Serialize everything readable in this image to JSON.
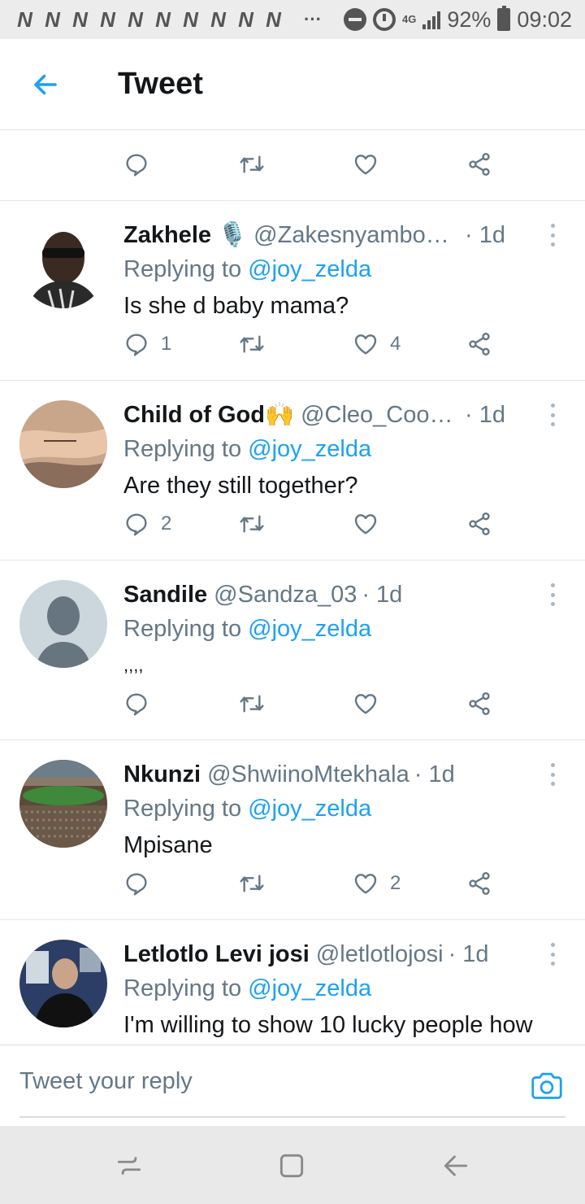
{
  "status_bar": {
    "notifications": [
      "N",
      "N",
      "N",
      "N",
      "N",
      "N",
      "N",
      "N",
      "N",
      "N"
    ],
    "more": "···",
    "network": "4G",
    "battery": "92%",
    "time": "09:02"
  },
  "header": {
    "title": "Tweet"
  },
  "tweets": [
    {
      "name": "Zakhele 🎙️",
      "handle": "@Zakesnyambose_",
      "time": "· 1d",
      "reply_prefix": "Replying to ",
      "reply_to": "@joy_zelda",
      "text": "Is she d baby mama?",
      "reply_count": "1",
      "like_count": "4"
    },
    {
      "name": "Child of God🙌",
      "handle": "@Cleo_Cooper...",
      "time": "· 1d",
      "reply_prefix": "Replying to ",
      "reply_to": "@joy_zelda",
      "text": "Are they still together?",
      "reply_count": "2",
      "like_count": ""
    },
    {
      "name": "Sandile",
      "handle": "@Sandza_03",
      "time": "· 1d",
      "reply_prefix": "Replying to ",
      "reply_to": "@joy_zelda",
      "text": ",,,,",
      "reply_count": "",
      "like_count": ""
    },
    {
      "name": "Nkunzi",
      "handle": "@ShwiinoMtekhala",
      "time": "· 1d",
      "reply_prefix": "Replying to ",
      "reply_to": "@joy_zelda",
      "text": "Mpisane",
      "reply_count": "",
      "like_count": "2"
    },
    {
      "name": "Letlotlo Levi josi",
      "handle": "@letlotlojosi",
      "time": "· 1d",
      "reply_prefix": "Replying to ",
      "reply_to": "@joy_zelda",
      "text": "I'm willing to show 10 lucky people how",
      "reply_count": "",
      "like_count": ""
    }
  ],
  "compose": {
    "placeholder": "Tweet your reply"
  },
  "colors": {
    "accent": "#1da1f2",
    "secondary_text": "#657786",
    "icon": "#657786",
    "divider": "#e1e8ed"
  }
}
